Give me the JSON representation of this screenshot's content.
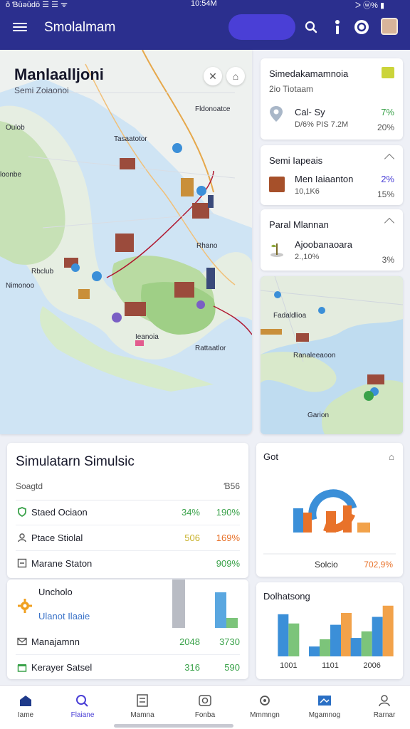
{
  "status_bar": {
    "left": "ǒ Ɓūǝūdō ☰ ☰ ᯤ",
    "time": "10:54M",
    "right": "ᐳ ⓦ% ▮"
  },
  "app": {
    "title": "Smolalmam"
  },
  "colors": {
    "primary": "#2b2f8e",
    "accent": "#4a3fd6",
    "green": "#3aa24a",
    "orange": "#e8722a",
    "blue": "#3b8fd8"
  },
  "icons": {
    "menu": "hamburger-icon",
    "search": "search-icon",
    "info": "info-icon",
    "help": "help-circle-icon",
    "profile": "avatar"
  },
  "map": {
    "title": "Manlaalljoni",
    "subtitle": "Semi Zoiaonoi",
    "labels": [
      "Fldonoatce",
      "Oulob",
      "Tasaatotor",
      "loonbe",
      "Nimonoo",
      "Rhano",
      "Ieanoia",
      "Rattaatlor",
      "Rbclub"
    ]
  },
  "stats": [
    {
      "title": "Simedakamamnoia",
      "subtitle": "2io Tiotaam",
      "rows": [
        {
          "label": "Cal- Sy",
          "sub": "D/6% PIS 7.2M",
          "pct": "7%",
          "pct2": "20%"
        }
      ]
    },
    {
      "title": "Semi Iapeais",
      "rows": [
        {
          "label": "Men Iaiaanton",
          "sub": "10,1K6",
          "pct": "2%",
          "pct2": "15%"
        }
      ]
    },
    {
      "title": "Paral Mlannan",
      "rows": [
        {
          "label": "Ajoobanaoara",
          "sub": "2.,10%",
          "pct": "3%"
        }
      ]
    }
  ],
  "mini_map": {
    "labels": [
      "Fadaldlioa",
      "Ranaleeaoon",
      "Garion"
    ]
  },
  "simulation": {
    "title": "Simulatarn Simulsic",
    "header_left": "Soagtd",
    "header_right": "Ɓ56",
    "rows": [
      {
        "label": "Staed Ociaon",
        "v1": "34%",
        "v2": "190%",
        "icon": "shield-icon"
      },
      {
        "label": "Ptace Stiolal",
        "v1": "506",
        "v2": "169%",
        "icon": "person-icon"
      },
      {
        "label": "Marane Staton",
        "v1": "",
        "v2": "909%",
        "icon": "table-icon"
      }
    ]
  },
  "lower": {
    "title": "Uncholo",
    "subtitle": "Ulanot Ilaaie",
    "rows": [
      {
        "label": "Manajamnn",
        "v1": "2048",
        "v2": "3730",
        "icon": "mail-icon"
      },
      {
        "label": "Kerayer Satsel",
        "v1": "316",
        "v2": "590",
        "icon": "gift-icon"
      }
    ]
  },
  "chart_gauge": {
    "title": "Got",
    "foot_label": "Solcio",
    "foot_value": "702,9%"
  },
  "chart_data": {
    "type": "bar",
    "title": "Dolhatsong",
    "categories": [
      "1001",
      "1101",
      "2006"
    ],
    "series": [
      {
        "values": [
          64,
          15,
          28
        ]
      },
      {
        "values": [
          50,
          26,
          38
        ]
      },
      {
        "values": [
          0,
          48,
          60
        ]
      },
      {
        "values": [
          0,
          66,
          77
        ]
      }
    ],
    "ylim": [
      0,
      80
    ]
  },
  "bottom_nav": [
    {
      "label": "Iame",
      "icon": "home-icon"
    },
    {
      "label": "Flaiane",
      "icon": "search-icon"
    },
    {
      "label": "Mamna",
      "icon": "calculator-icon"
    },
    {
      "label": "Fonba",
      "icon": "camera-icon"
    },
    {
      "label": "Mmmngn",
      "icon": "settings-icon"
    },
    {
      "label": "Mgamnog",
      "icon": "map-icon"
    },
    {
      "label": "Rarnar",
      "icon": "profile-icon"
    }
  ]
}
